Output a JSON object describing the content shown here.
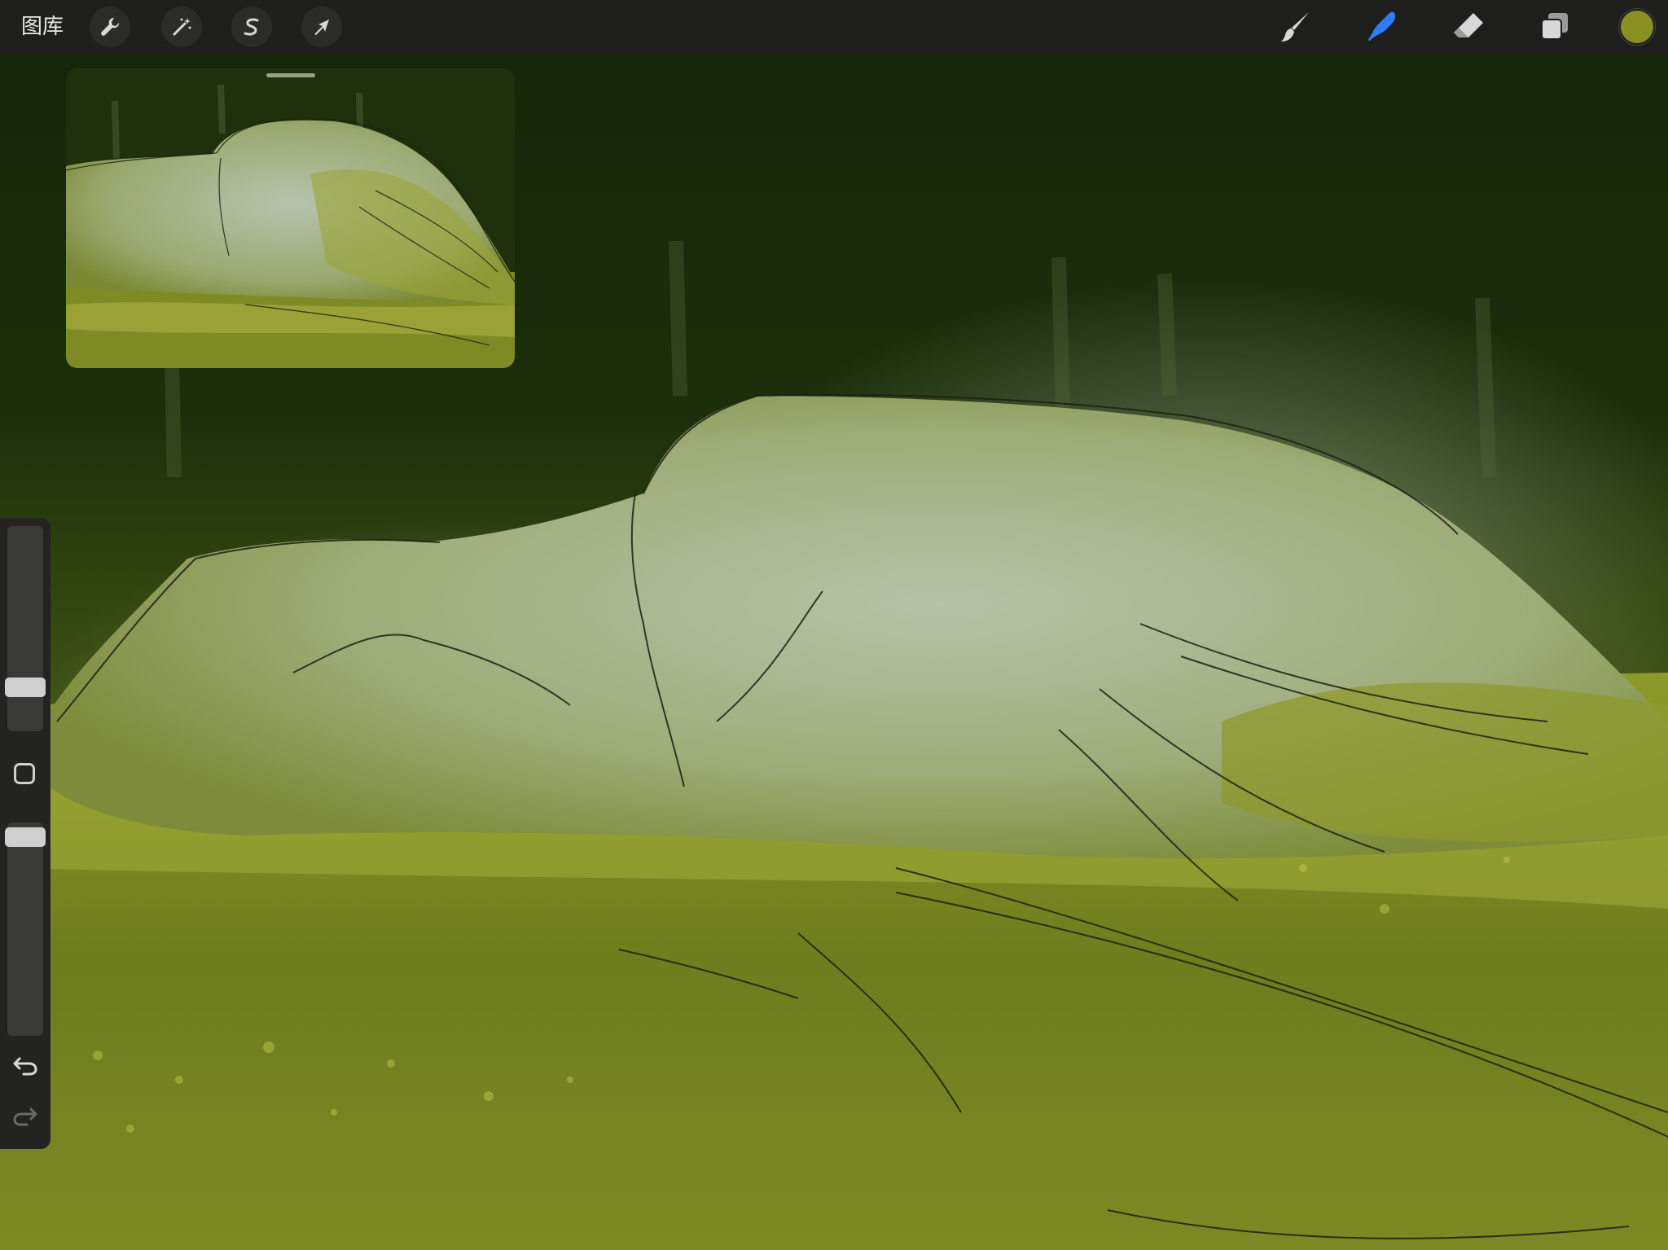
{
  "toolbar": {
    "gallery_label": "图库",
    "actions_icon": "wrench-icon",
    "adjustments_icon": "magic-wand-icon",
    "selection_icon": "selection-s-icon",
    "transform_icon": "arrow-cursor-icon",
    "brush_icon": "brush-icon",
    "smudge_icon": "smudge-finger-icon",
    "eraser_icon": "eraser-icon",
    "layers_icon": "layers-icon",
    "active_tool": "smudge",
    "active_color": "#8a8f23",
    "active_tool_color": "#2f7cf6"
  },
  "sidebar": {
    "size_slider_level": 0.73,
    "opacity_slider_level": 0.95,
    "modify_button_icon": "square-icon",
    "undo_icon": "undo-icon",
    "redo_icon": "redo-icon"
  }
}
